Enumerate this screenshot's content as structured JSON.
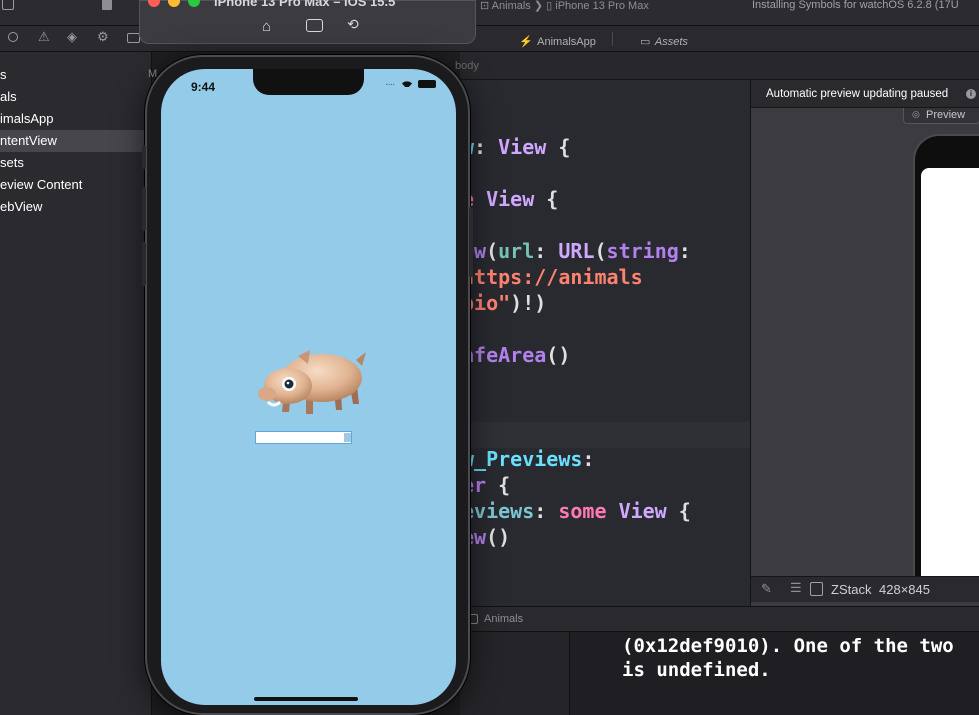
{
  "xcode": {
    "toolbar": {
      "breadcrumb_project": "Animals",
      "breadcrumb_device": "iPhone 13 Pro Max",
      "activity_status": "Installing Symbols for watchOS 6.2.8 (17U"
    },
    "tabs": [
      {
        "label": "AnimalsApp"
      },
      {
        "label": "Assets"
      }
    ],
    "jumpbar": {
      "item": "body"
    },
    "navigator": {
      "rows": [
        {
          "label": "s"
        },
        {
          "label": "als"
        },
        {
          "label": "imalsApp"
        },
        {
          "label": "ntentView"
        },
        {
          "label": "sets"
        },
        {
          "label": "eview Content"
        },
        {
          "label": "ebView"
        }
      ],
      "column_label": "M"
    },
    "canvas": {
      "status": "Automatic preview updating paused",
      "preview_button": "Preview",
      "bottom_selection": "ZStack",
      "bottom_size": "428×845"
    },
    "debug": {
      "target_label": "Animals",
      "console_lines": [
        "(0x12def9010). One of the two",
        "is undefined."
      ]
    }
  },
  "simulator": {
    "title": "iPhone 13 Pro Max – iOS 15.5",
    "status_time": "9:44",
    "loading_progress": 0.92
  },
  "colors": {
    "accent": "#94cbe8",
    "keyword": "#ff7ab2",
    "string": "#ff8170",
    "type": "#d0a8ff"
  }
}
